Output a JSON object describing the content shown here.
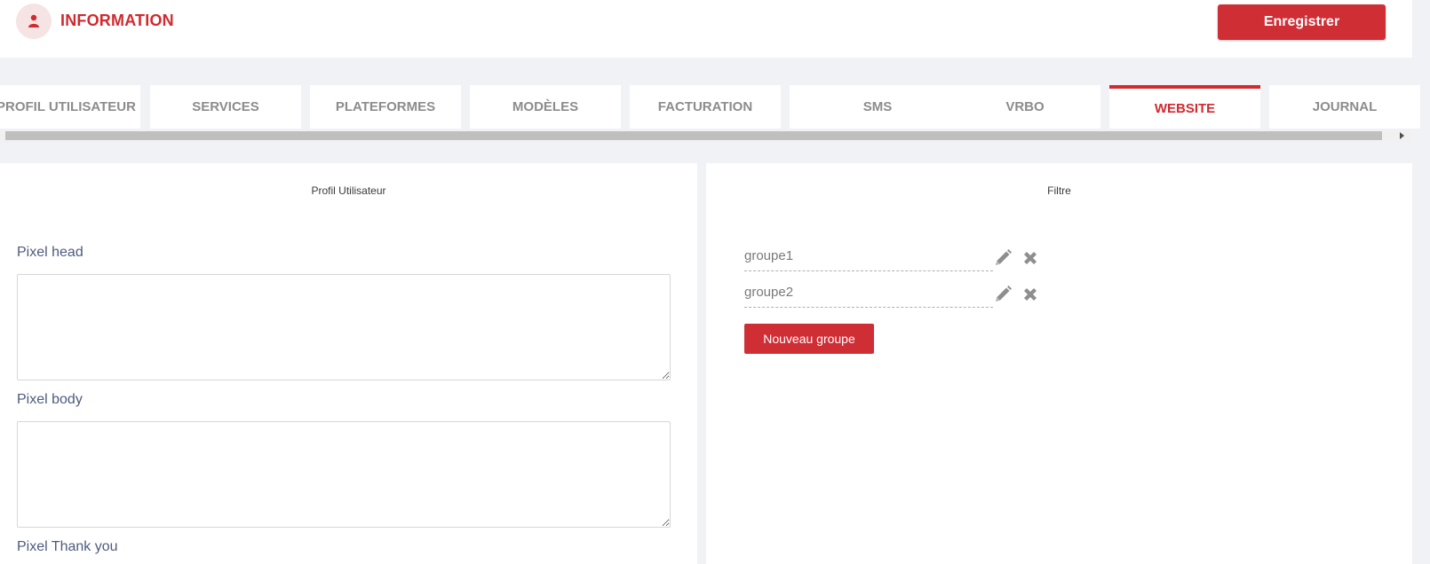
{
  "header": {
    "title": "INFORMATION",
    "save_label": "Enregistrer",
    "avatar_icon": "user-icon",
    "accent_color": "#d12a2f"
  },
  "tabs": [
    {
      "label": "PROFIL UTILISATEUR",
      "active": false
    },
    {
      "label": "SERVICES",
      "active": false
    },
    {
      "label": "PLATEFORMES",
      "active": false
    },
    {
      "label": "MODÈLES",
      "active": false
    },
    {
      "label": "FACTURATION",
      "active": false
    },
    {
      "label": "SMS",
      "active": false
    },
    {
      "label": "VRBO",
      "active": false
    },
    {
      "label": "WEBSITE",
      "active": true
    },
    {
      "label": "JOURNAL",
      "active": false
    }
  ],
  "left_panel": {
    "heading": "Profil Utilisateur",
    "fields": [
      {
        "label": "Pixel head",
        "value": ""
      },
      {
        "label": "Pixel body",
        "value": ""
      },
      {
        "label": "Pixel Thank you",
        "value": ""
      }
    ]
  },
  "right_panel": {
    "heading": "Filtre",
    "groups": [
      {
        "name": "groupe1",
        "edit_icon": "pencil-icon",
        "delete_icon": "close-icon"
      },
      {
        "name": "groupe2",
        "edit_icon": "pencil-icon",
        "delete_icon": "close-icon"
      }
    ],
    "new_group_label": "Nouveau groupe"
  }
}
